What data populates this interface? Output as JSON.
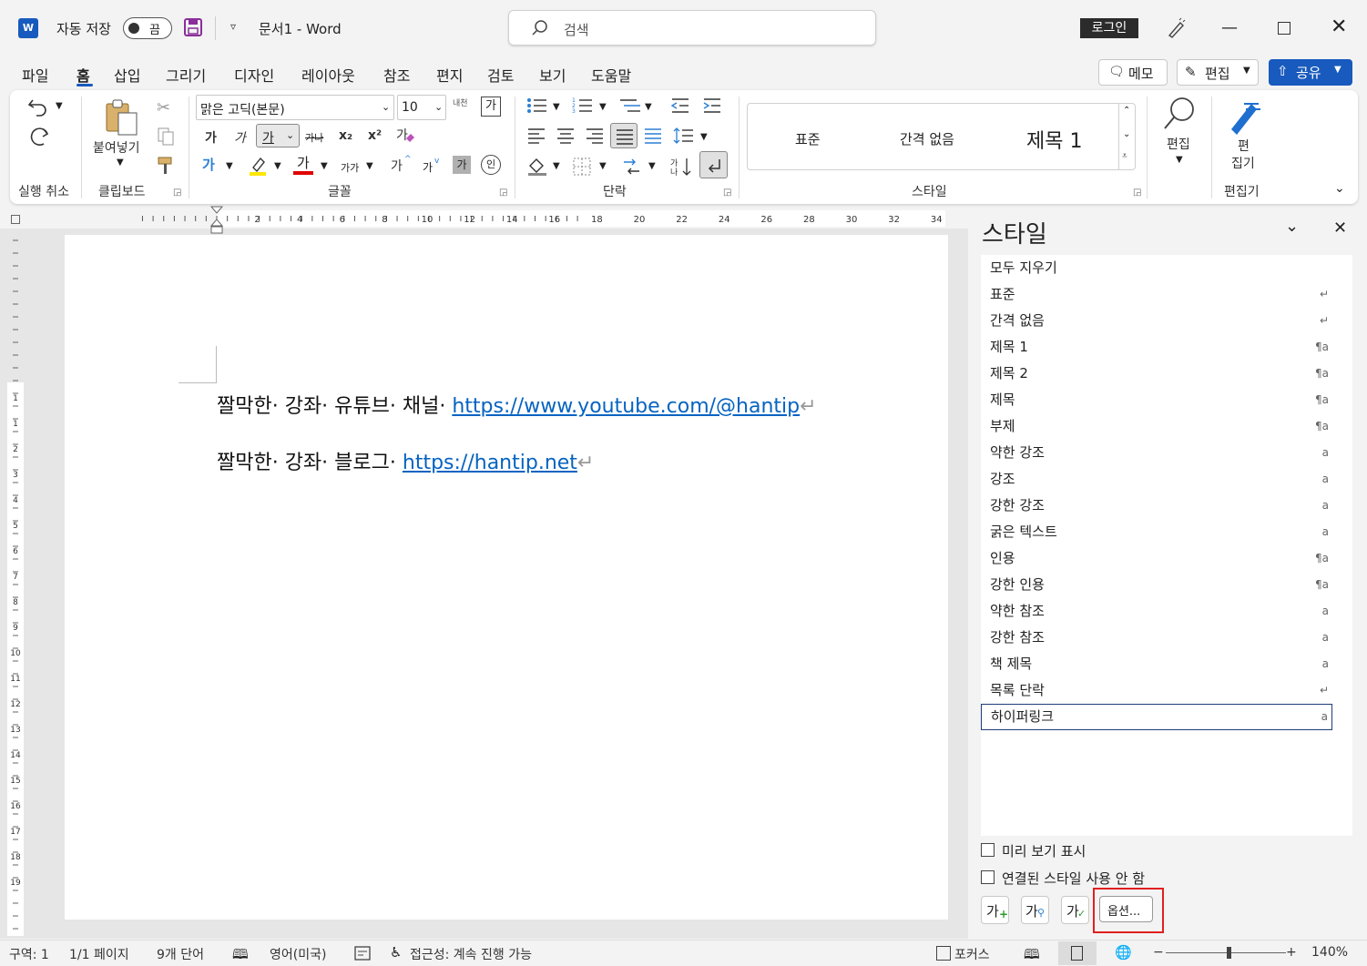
{
  "titlebar": {
    "app_icon": "word-icon",
    "autosave_label": "자동 저장",
    "autosave_state": "끔",
    "doc_title": "문서1  -  Word",
    "search_placeholder": "검색",
    "login_label": "로그인"
  },
  "menu": {
    "tabs": [
      "파일",
      "홈",
      "삽입",
      "그리기",
      "디자인",
      "레이아웃",
      "참조",
      "편지",
      "검토",
      "보기",
      "도움말"
    ],
    "active": "홈",
    "memo_label": "메모",
    "edit_label": "편집",
    "share_label": "공유"
  },
  "ribbon": {
    "groups": {
      "undo": "실행 취소",
      "clipboard": "클립보드",
      "font": "글꼴",
      "paragraph": "단락",
      "styles": "스타일",
      "editor": "편집기"
    },
    "paste_label": "붙여넣기",
    "font_name": "맑은 고딕(본문)",
    "font_size": "10",
    "gallery_styles": [
      "표준",
      "간격 없음",
      "제목 1"
    ],
    "editing_label": "편집",
    "editor_label": "편\n집기",
    "font_buttons": {
      "bold": "가",
      "italic": "가",
      "underline": "가",
      "strike": "가나",
      "sub": "x₂",
      "sup": "x²",
      "grow": "가",
      "shrink": "가",
      "case": "가가",
      "highlight_text": "가",
      "charshade": "가",
      "enclose": "인",
      "font_color_text": "가",
      "clear": "가",
      "phonetic": "내천",
      "charborder": "가"
    }
  },
  "ruler": {
    "numbers": [
      "2",
      "4",
      "6",
      "8",
      "10",
      "12",
      "14",
      "16",
      "18",
      "20",
      "22",
      "24",
      "26",
      "28",
      "30",
      "32",
      "34"
    ],
    "vnumbers": [
      "1",
      "1",
      "2",
      "3",
      "4",
      "5",
      "6",
      "7",
      "8",
      "9",
      "10",
      "11",
      "12",
      "13",
      "14",
      "15",
      "16",
      "17",
      "18",
      "19"
    ]
  },
  "document": {
    "line1_text": "짤막한· 강좌· 유튜브· 채널·",
    "line1_link": "https://www.youtube.com/@hantip",
    "line2_text": "짤막한· 강좌· 블로그·",
    "line2_link": "https://hantip.net",
    "para_mark": "↵"
  },
  "styles_pane": {
    "title": "스타일",
    "items": [
      {
        "name": "모두 지우기",
        "ind": ""
      },
      {
        "name": "표준",
        "ind": "↵"
      },
      {
        "name": "간격 없음",
        "ind": "↵"
      },
      {
        "name": "제목 1",
        "ind": "¶a"
      },
      {
        "name": "제목 2",
        "ind": "¶a"
      },
      {
        "name": "제목",
        "ind": "¶a"
      },
      {
        "name": "부제",
        "ind": "¶a"
      },
      {
        "name": "약한 강조",
        "ind": "a"
      },
      {
        "name": "강조",
        "ind": "a"
      },
      {
        "name": "강한 강조",
        "ind": "a"
      },
      {
        "name": "굵은 텍스트",
        "ind": "a"
      },
      {
        "name": "인용",
        "ind": "¶a"
      },
      {
        "name": "강한 인용",
        "ind": "¶a"
      },
      {
        "name": "약한 참조",
        "ind": "a"
      },
      {
        "name": "강한 참조",
        "ind": "a"
      },
      {
        "name": "책 제목",
        "ind": "a"
      },
      {
        "name": "목록 단락",
        "ind": "↵"
      },
      {
        "name": "하이퍼링크",
        "ind": "a"
      }
    ],
    "selected": "하이퍼링크",
    "preview_label": "미리 보기 표시",
    "linked_label": "연결된 스타일 사용 안 함",
    "new_style_glyph": "가",
    "inspect_glyph": "가",
    "manage_glyph": "가",
    "options_label": "옵션...",
    "highlight_color": "#e02020"
  },
  "statusbar": {
    "section": "구역: 1",
    "page": "1/1 페이지",
    "words": "9개 단어",
    "language": "영어(미국)",
    "accessibility": "접근성: 계속 진행 가능",
    "focus": "포커스",
    "zoom": "140%",
    "zoom_minus": "−",
    "zoom_plus": "+"
  }
}
